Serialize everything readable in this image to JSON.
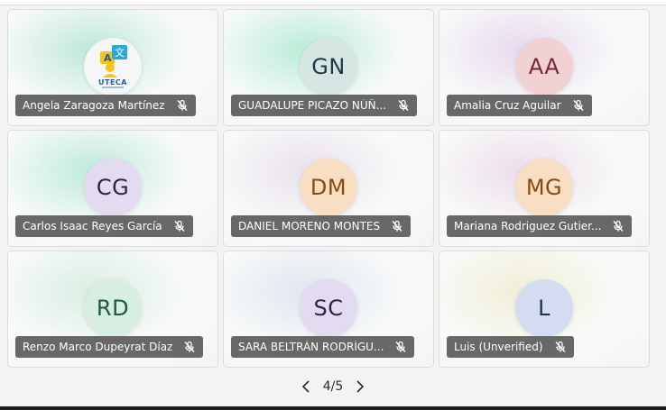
{
  "pager": {
    "label": "4/5"
  },
  "participants": [
    {
      "name": "Angela Zaragoza Martínez",
      "initials": "",
      "avatar": "logo-icon",
      "logo_text": "UTECA",
      "avatar_bg": "#f4f4f4",
      "avatar_fg": "#2a2a2a",
      "glow": "#bfe8d9"
    },
    {
      "name": "GUADALUPE PICAZO NÚÑ...",
      "initials": "GN",
      "avatar_bg": "#d6e6e2",
      "avatar_fg": "#1f3a44",
      "glow": "#b8ecd7"
    },
    {
      "name": "Amalia Cruz Aguilar",
      "initials": "AA",
      "avatar_bg": "#f1d2d4",
      "avatar_fg": "#7a2630",
      "glow": "#e7d9ee"
    },
    {
      "name": "Carlos Isaac Reyes García",
      "initials": "CG",
      "avatar_bg": "#e3dcf0",
      "avatar_fg": "#2e2447",
      "glow": "#bfeadc"
    },
    {
      "name": "DANIEL MORENO MONTES",
      "initials": "DM",
      "avatar_bg": "#f8dec3",
      "avatar_fg": "#8a4a0f",
      "glow": "#e9e2ec"
    },
    {
      "name": "Mariana Rodriguez Gutier...",
      "initials": "MG",
      "avatar_bg": "#f8dec3",
      "avatar_fg": "#8a4a0f",
      "glow": "#ebdeea"
    },
    {
      "name": "Renzo Marco Dupeyrat Díaz",
      "initials": "RD",
      "avatar_bg": "#d8eee3",
      "avatar_fg": "#1d5a3b",
      "glow": "#d9eee3"
    },
    {
      "name": "SARA BELTRÁN RODRÍGU...",
      "initials": "SC",
      "avatar_bg": "#e3dcf0",
      "avatar_fg": "#2e2447",
      "glow": "#dfe6f0"
    },
    {
      "name": "Luis (Unverified)",
      "initials": "L",
      "avatar_bg": "#d3dcf0",
      "avatar_fg": "#1f2d55",
      "glow": "#f1eed7"
    }
  ],
  "colors": {
    "nameplate_bg": "#5c5c5c",
    "tile_border": "#dcdcdc",
    "page_bg": "#f3f3f3"
  }
}
